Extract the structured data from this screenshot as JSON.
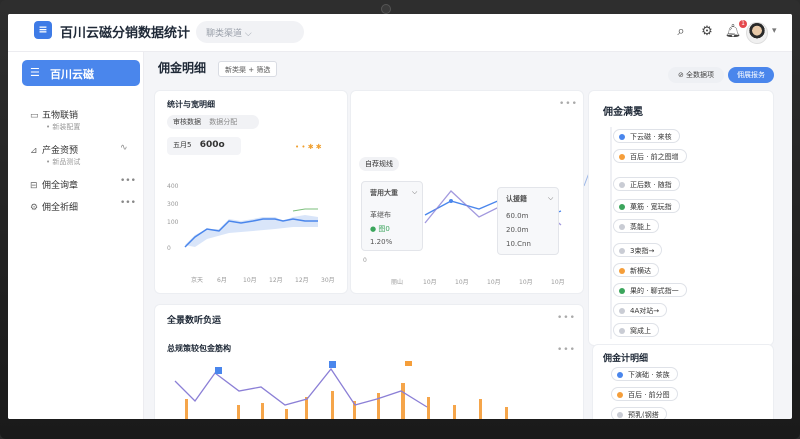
{
  "header": {
    "app_title": "百川云磁分销数据统计",
    "selector_placeholder": "聊类渠道",
    "icons": [
      "search-icon",
      "settings-icon",
      "bell-icon"
    ],
    "notification_count": "1"
  },
  "sidebar": {
    "active": "百川云磁",
    "items": [
      {
        "label": "五物联销",
        "sub": "• 新装配置",
        "more": ""
      },
      {
        "label": "产金资预",
        "sub": "• 新品测试",
        "more": "∿"
      },
      {
        "label": "佣全询章",
        "sub": "",
        "more": "•••"
      },
      {
        "label": "佣全祈细",
        "sub": "",
        "more": "•••"
      }
    ]
  },
  "page": {
    "title": "佣金明细",
    "chip": "新类渠 + 筛选",
    "btn_outline": "⊘ 全数据项",
    "btn_primary": "佣展报务"
  },
  "card_stats": {
    "title": "统计与宽明细",
    "tabs": [
      "审核数据",
      "数据分配"
    ],
    "metric_label": "五月5",
    "metric_value": "600o",
    "y_ticks": [
      "400",
      "300",
      "100",
      "0"
    ],
    "x_ticks": [
      "京天",
      "6月",
      "10月",
      "12月",
      "12月",
      "30月"
    ]
  },
  "card_trend": {
    "title": "自荐规线",
    "tooltip_a": {
      "title": "营用大重",
      "rows": [
        "革继布",
        "● 图0",
        "1.20%"
      ]
    },
    "tooltip_b": {
      "title": "认援籍",
      "rows": [
        "60.0m",
        "20.0m",
        "10.Cnn"
      ]
    },
    "x_ticks": [
      "丽山",
      "10月",
      "10月",
      "10月",
      "10月",
      "10月"
    ],
    "y_zero": "0"
  },
  "card_tree": {
    "title": "佣金满冕",
    "nodes": [
      "下云磁 · 来核",
      "百后 · 前之图增",
      "正后数 · 随指",
      "菓筋 · 宽玩指",
      "蒸能上",
      "3束指→",
      "新横达",
      "果的 · 聊式指一",
      "4A对站→",
      "窝成上"
    ]
  },
  "card_bottom_left": {
    "title": "全景数听负运",
    "subtitle": "总规策较包金筋构"
  },
  "card_bottom_right": {
    "title": "佣金计明细",
    "nodes": [
      "下演础 · 茶族",
      "百后 · 前分图",
      "预乳(钢搭"
    ]
  },
  "colors": {
    "accent": "#4a86ec",
    "orange": "#f59e3a",
    "purple": "#8b7fd6",
    "green": "#3ba55c"
  }
}
